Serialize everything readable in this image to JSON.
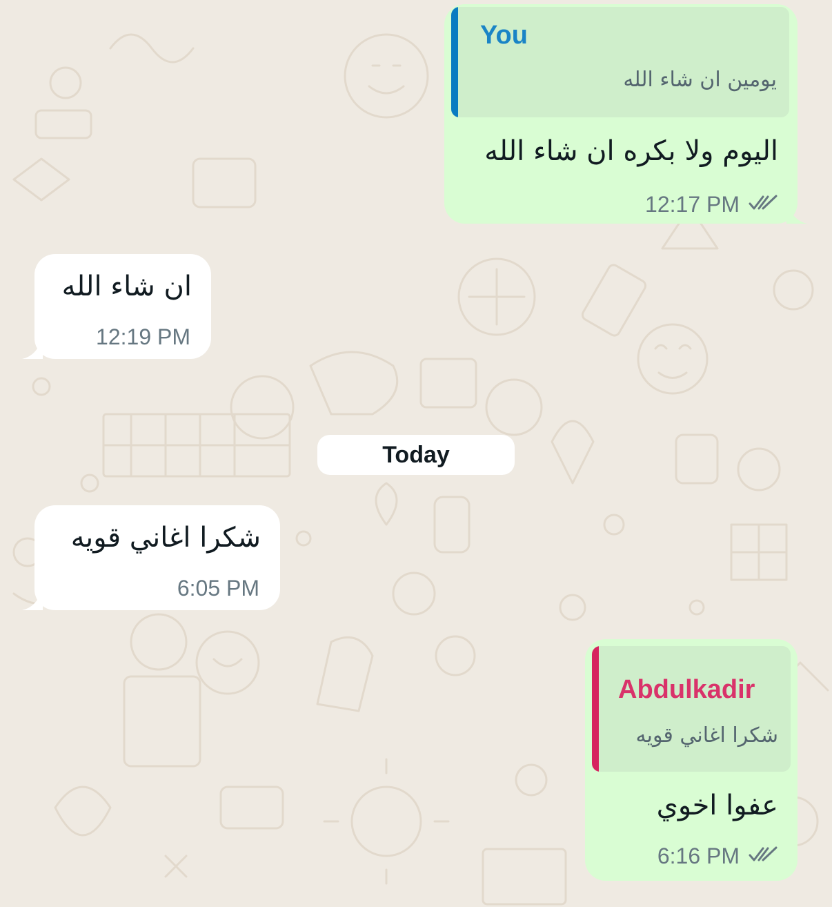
{
  "colors": {
    "outgoing_bubble": "#d9fdd3",
    "incoming_bubble": "#ffffff",
    "quote_you_bar": "#0a7cc1",
    "quote_you_name": "#1a84c6",
    "quote_other_bar": "#d6245f",
    "quote_other_name": "#d9326a",
    "read_ticks": "#667781",
    "wallpaper": "#efeae2"
  },
  "messages": [
    {
      "direction": "outgoing",
      "reply": {
        "author": "You",
        "text": "يومين ان شاء الله"
      },
      "text": "اليوم ولا بكره ان شاء الله",
      "time": "12:17 PM",
      "status_icon": "double-check-icon"
    },
    {
      "direction": "incoming",
      "text": "ان شاء الله",
      "time": "12:19 PM"
    },
    {
      "direction": "incoming",
      "text": "شكرا اغاني قويه",
      "time": "6:05 PM"
    },
    {
      "direction": "outgoing",
      "reply": {
        "author": "Abdulkadir",
        "text": "شكرا اغاني قويه"
      },
      "text": "عفوا اخوي",
      "time": "6:16 PM",
      "status_icon": "double-check-icon"
    }
  ],
  "date_divider": "Today"
}
